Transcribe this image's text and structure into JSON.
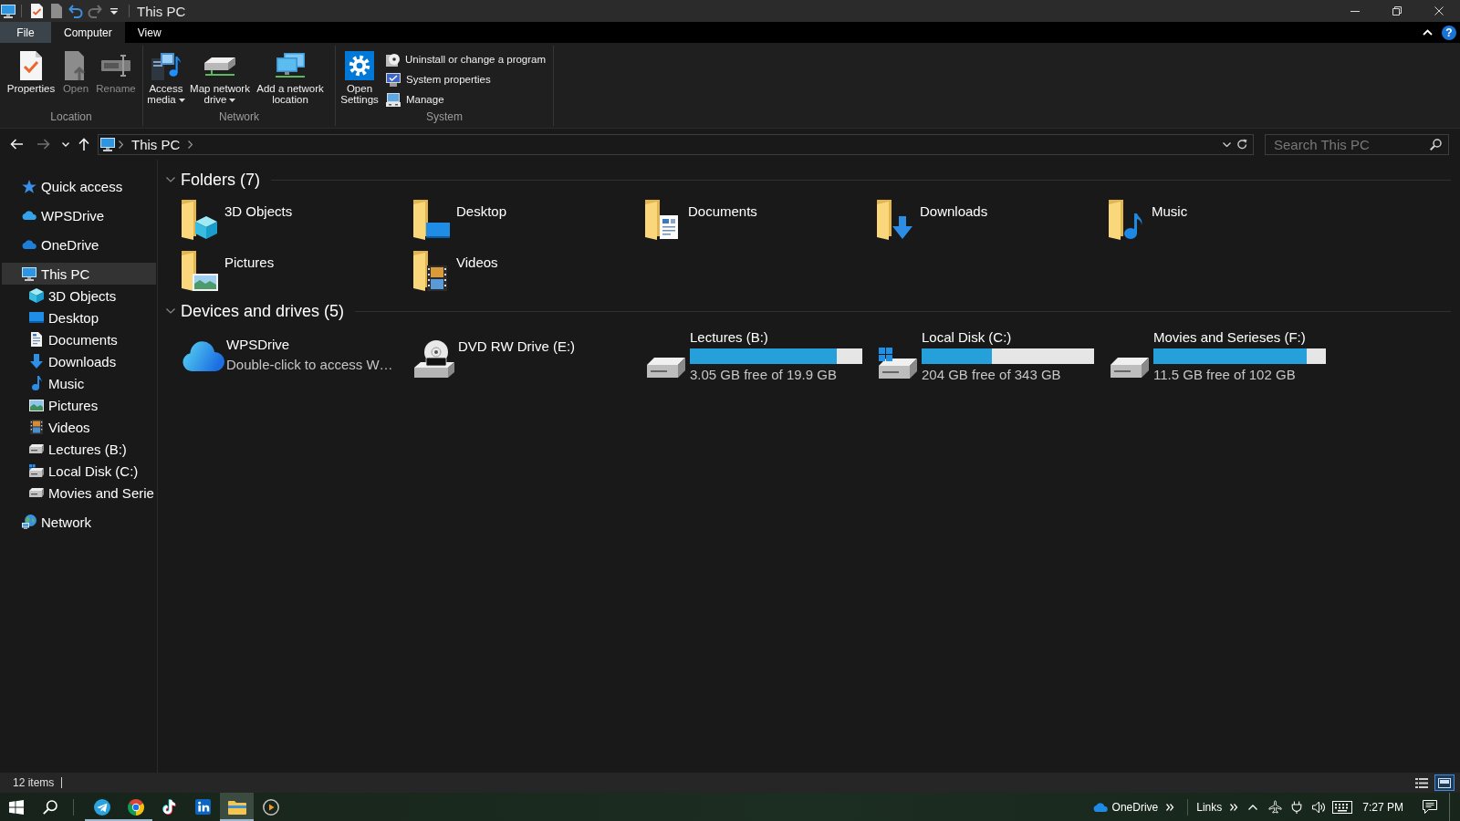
{
  "window": {
    "title": "This PC"
  },
  "quick_access_toolbar": [
    {
      "kind": "properties",
      "disabled": false
    },
    {
      "kind": "new_folder",
      "disabled": true
    },
    {
      "kind": "undo",
      "disabled": false
    },
    {
      "kind": "redo",
      "disabled": true
    },
    {
      "kind": "customize",
      "disabled": false
    }
  ],
  "ribbon": {
    "tabs": [
      {
        "label": "File",
        "kind": "backstage",
        "selected": false
      },
      {
        "label": "Computer",
        "kind": "tab",
        "selected": true
      },
      {
        "label": "View",
        "kind": "tab",
        "selected": false
      }
    ],
    "help": "?",
    "groups": [
      {
        "label": "Location",
        "buttons": [
          {
            "label": "Properties",
            "kind": "large",
            "disabled": false,
            "dropdown": false
          },
          {
            "label": "Open",
            "kind": "large",
            "disabled": true,
            "dropdown": false
          },
          {
            "label": "Rename",
            "kind": "large",
            "disabled": true,
            "dropdown": false
          }
        ]
      },
      {
        "label": "Network",
        "buttons": [
          {
            "label": "Access media",
            "kind": "large",
            "disabled": false,
            "dropdown": true
          },
          {
            "label": "Map network drive",
            "kind": "large",
            "disabled": false,
            "dropdown": true
          },
          {
            "label": "Add a network location",
            "kind": "large",
            "disabled": false,
            "dropdown": false
          }
        ]
      },
      {
        "label": "System",
        "buttons": [
          {
            "label": "Open Settings",
            "kind": "large",
            "disabled": false,
            "dropdown": false
          },
          {
            "label": "Uninstall or change a program",
            "kind": "small",
            "disabled": false,
            "dropdown": false
          },
          {
            "label": "System properties",
            "kind": "small",
            "disabled": false,
            "dropdown": false
          },
          {
            "label": "Manage",
            "kind": "small",
            "disabled": false,
            "dropdown": false
          }
        ]
      }
    ]
  },
  "navigation": [
    {
      "kind": "back",
      "disabled": false
    },
    {
      "kind": "forward",
      "disabled": true
    },
    {
      "kind": "recent",
      "disabled": false
    },
    {
      "kind": "up",
      "disabled": false
    }
  ],
  "address_bar": {
    "breadcrumb": [
      "This PC"
    ]
  },
  "search": {
    "placeholder": "Search This PC"
  },
  "sidebar": {
    "items": [
      {
        "label": "Quick access",
        "selected": false
      },
      {
        "label": "WPSDrive",
        "selected": false
      },
      {
        "label": "OneDrive",
        "selected": false
      },
      {
        "label": "This PC",
        "selected": true,
        "children": [
          {
            "label": "3D Objects",
            "selected": false
          },
          {
            "label": "Desktop",
            "selected": false
          },
          {
            "label": "Documents",
            "selected": false
          },
          {
            "label": "Downloads",
            "selected": false
          },
          {
            "label": "Music",
            "selected": false
          },
          {
            "label": "Pictures",
            "selected": false
          },
          {
            "label": "Videos",
            "selected": false
          },
          {
            "label": "Lectures (B:)",
            "selected": false
          },
          {
            "label": "Local Disk (C:)",
            "selected": false
          },
          {
            "label": "Movies and Serie",
            "selected": false
          }
        ]
      },
      {
        "label": "Network",
        "selected": false
      }
    ]
  },
  "sections": [
    {
      "kind": "folders",
      "title": "Folders (7)",
      "items": [
        {
          "label": "3D Objects"
        },
        {
          "label": "Desktop"
        },
        {
          "label": "Documents"
        },
        {
          "label": "Downloads"
        },
        {
          "label": "Music"
        },
        {
          "label": "Pictures"
        },
        {
          "label": "Videos"
        }
      ]
    },
    {
      "kind": "drives",
      "title": "Devices and drives (5)",
      "items": [
        {
          "kind": "cloud",
          "name": "WPSDrive",
          "subtitle": "Double-click to access W…"
        },
        {
          "kind": "optical",
          "name": "DVD RW Drive (E:)"
        },
        {
          "kind": "disk",
          "name": "Lectures (B:)",
          "level": 0.85,
          "free": "3.05 GB free of 19.9 GB"
        },
        {
          "kind": "system",
          "name": "Local Disk (C:)",
          "level": 0.41,
          "free": "204 GB free of 343 GB"
        },
        {
          "kind": "disk",
          "name": "Movies and Serieses (F:)",
          "level": 0.89,
          "free": "11.5 GB free of 102 GB"
        }
      ]
    }
  ],
  "status_bar": {
    "item_count": "12 items",
    "view_modes": [
      {
        "kind": "details",
        "selected": false
      },
      {
        "kind": "large_icons",
        "selected": true
      }
    ]
  },
  "taskbar": {
    "apps": [
      {
        "kind": "messenger",
        "running": true,
        "selected": false
      },
      {
        "kind": "browser",
        "running": true,
        "selected": false
      },
      {
        "kind": "video",
        "running": false,
        "selected": false
      },
      {
        "kind": "network",
        "running": false,
        "selected": false
      },
      {
        "kind": "files",
        "running": true,
        "selected": true
      },
      {
        "kind": "player",
        "running": false,
        "selected": false
      }
    ],
    "toolbars": [
      {
        "label": "OneDrive"
      },
      {
        "label": "Links"
      }
    ],
    "clock": "7:27 PM"
  }
}
